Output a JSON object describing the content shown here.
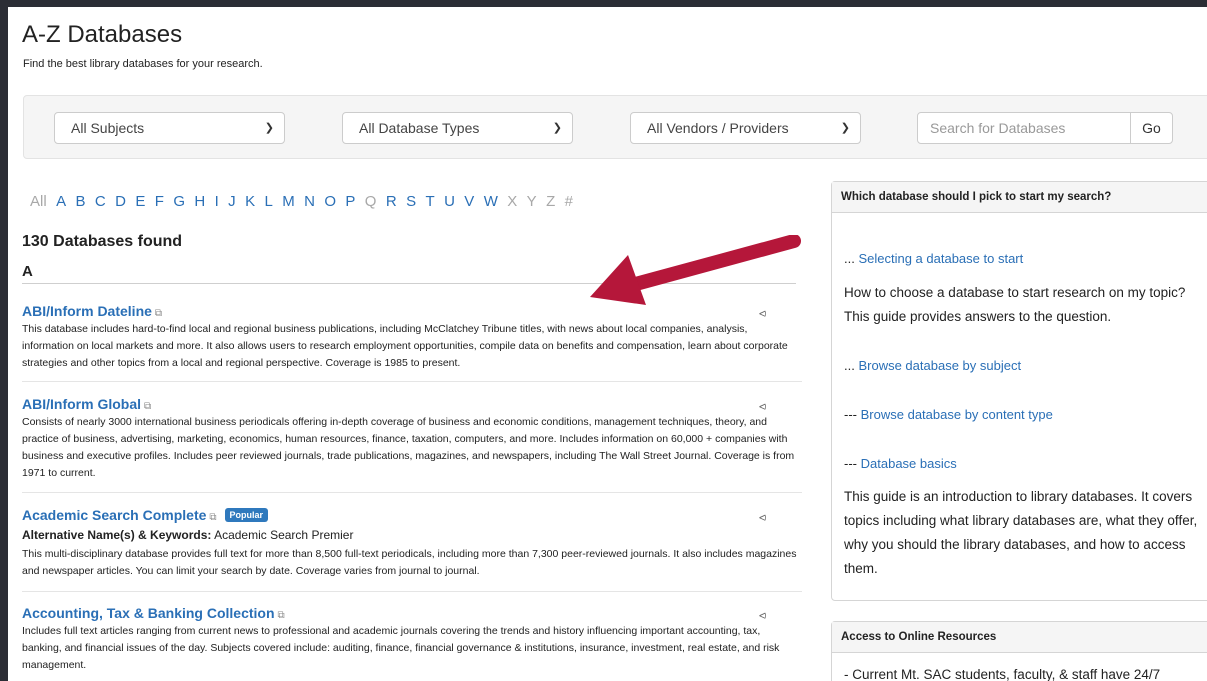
{
  "header": {
    "title": "A-Z Databases",
    "subtitle": "Find the best library databases for your research."
  },
  "filters": {
    "subjects": "All Subjects",
    "types": "All Database Types",
    "vendors": "All Vendors / Providers",
    "search_placeholder": "Search for Databases",
    "go_label": "Go"
  },
  "az": [
    {
      "l": "All",
      "on": false
    },
    {
      "l": "A",
      "on": true
    },
    {
      "l": "B",
      "on": true
    },
    {
      "l": "C",
      "on": true
    },
    {
      "l": "D",
      "on": true
    },
    {
      "l": "E",
      "on": true
    },
    {
      "l": "F",
      "on": true
    },
    {
      "l": "G",
      "on": true
    },
    {
      "l": "H",
      "on": true
    },
    {
      "l": "I",
      "on": true
    },
    {
      "l": "J",
      "on": true
    },
    {
      "l": "K",
      "on": true
    },
    {
      "l": "L",
      "on": true
    },
    {
      "l": "M",
      "on": true
    },
    {
      "l": "N",
      "on": true
    },
    {
      "l": "O",
      "on": true
    },
    {
      "l": "P",
      "on": true
    },
    {
      "l": "Q",
      "on": false
    },
    {
      "l": "R",
      "on": true
    },
    {
      "l": "S",
      "on": true
    },
    {
      "l": "T",
      "on": true
    },
    {
      "l": "U",
      "on": true
    },
    {
      "l": "V",
      "on": true
    },
    {
      "l": "W",
      "on": true
    },
    {
      "l": "X",
      "on": false
    },
    {
      "l": "Y",
      "on": false
    },
    {
      "l": "Z",
      "on": false
    },
    {
      "l": "#",
      "on": false
    }
  ],
  "results": {
    "count_label": "130 Databases found",
    "section_letter": "A",
    "items": [
      {
        "title": "ABI/Inform Dateline",
        "desc": "This database includes hard-to-find local and regional business publications, including McClatchey Tribune titles, with news about local companies, analysis, information on local markets and more. It also allows users to research employment opportunities, compile data on benefits and compensation, learn about corporate strategies and other topics from a local and regional perspective. Coverage is 1985 to present."
      },
      {
        "title": "ABI/Inform Global",
        "desc": "Consists of nearly 3000 international business periodicals offering in-depth coverage of business and economic conditions, management techniques, theory, and practice of business, advertising, marketing, economics, human resources, finance, taxation, computers, and more. Includes information on 60,000 + companies with business and executive profiles. Includes peer reviewed journals, trade publications, magazines, and newspapers, including The Wall Street Journal. Coverage is from 1971 to current."
      },
      {
        "title": "Academic Search Complete",
        "badge": "Popular",
        "alt_label": "Alternative Name(s) & Keywords:",
        "alt_value": "Academic Search Premier",
        "desc": "This multi-disciplinary database provides full text for more than 8,500 full-text periodicals, including more than 7,300 peer-reviewed journals. It also includes magazines and newspaper articles. You can limit your search by date. Coverage varies from journal to journal."
      },
      {
        "title": "Accounting, Tax & Banking Collection",
        "desc": "Includes full text articles ranging from current news to professional and academic journals covering the trends and history influencing important accounting, tax, banking, and financial issues of the day. Subjects covered include: auditing, finance, financial governance & institutions, insurance, investment, real estate, and risk management."
      }
    ]
  },
  "sidebar": {
    "panel1": {
      "heading": "Which database should I pick to start my search?",
      "link1_prefix": "...",
      "link1": "Selecting a database to start",
      "text1": "How to choose a database to start research on my topic? This guide provides answers to the question.",
      "link2_prefix": "...",
      "link2": "Browse database by subject",
      "link3_prefix": "---",
      "link3": "Browse database by content type",
      "link4_prefix": "---",
      "link4": "Database basics",
      "text2": "This guide is an introduction to library databases. It covers topics including what library databases are, what they offer, why you should the library databases, and how to access them."
    },
    "panel2": {
      "heading": "Access to Online Resources",
      "text": "- Current Mt. SAC students, faculty, & staff have 24/7"
    }
  },
  "icons": {
    "external": "external-link-icon",
    "share": "share-icon",
    "chevron": "chevron-down-icon",
    "arrow": "annotation-arrow"
  },
  "colors": {
    "link": "#2a6fb6",
    "badge": "#2f79bd",
    "arrow": "#b5173a",
    "frame": "#2b2d35"
  }
}
